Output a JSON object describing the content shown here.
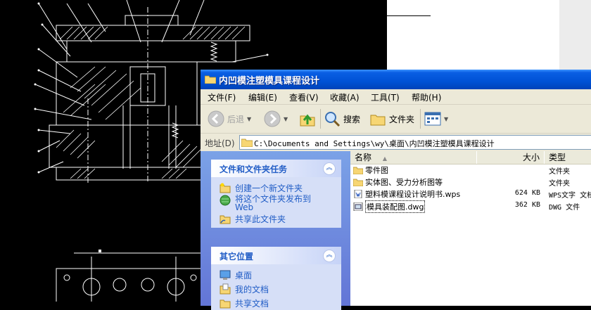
{
  "window": {
    "title": "内凹模注塑模具课程设计"
  },
  "menu": [
    "文件(F)",
    "编辑(E)",
    "查看(V)",
    "收藏(A)",
    "工具(T)",
    "帮助(H)"
  ],
  "toolbar": {
    "back": "后退",
    "search": "搜索",
    "folders": "文件夹"
  },
  "address": {
    "label": "地址(D)",
    "path": "C:\\Documents and Settings\\wy\\桌面\\内凹模注塑模具课程设计"
  },
  "tasks_panel": {
    "title": "文件和文件夹任务",
    "items": [
      "创建一个新文件夹",
      "将这个文件夹发布到\nWeb",
      "共享此文件夹"
    ]
  },
  "places_panel": {
    "title": "其它位置",
    "items": [
      "桌面",
      "我的文档",
      "共享文档"
    ]
  },
  "columns": {
    "name": "名称",
    "size": "大小",
    "type": "类型"
  },
  "files": [
    {
      "name": "零件图",
      "size": "",
      "type": "文件夹",
      "icon": "folder-icon"
    },
    {
      "name": "实体图、受力分析图等",
      "size": "",
      "type": "文件夹",
      "icon": "folder-icon"
    },
    {
      "name": "塑料模课程设计说明书.wps",
      "size": "624 KB",
      "type": "WPS文字 文档",
      "icon": "wps-file-icon"
    },
    {
      "name": "模具装配图.dwg",
      "size": "362 KB",
      "type": "DWG 文件",
      "icon": "dwg-file-icon"
    }
  ]
}
